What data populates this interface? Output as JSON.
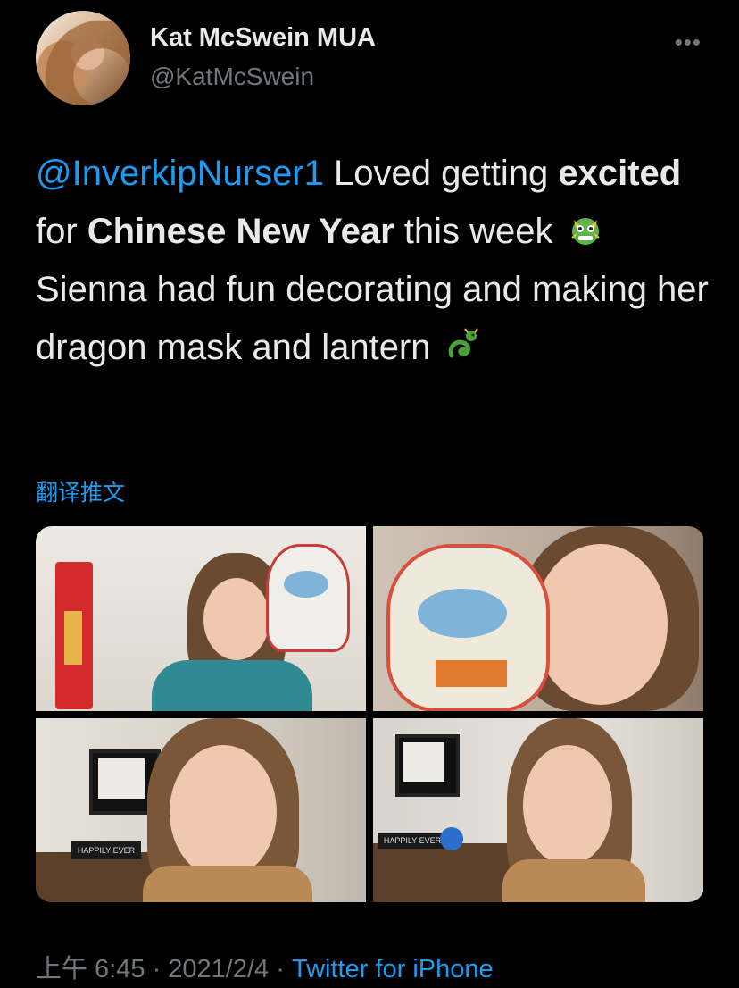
{
  "author": {
    "display_name": "Kat McSwein MUA",
    "handle": "@KatMcSwein"
  },
  "tweet": {
    "mention": "@InverkipNurser1",
    "t1": " Loved getting ",
    "b1": "excited",
    "t2": " for ",
    "b2": "Chinese New Year",
    "t3": " this week ",
    "t4": " Sienna had fun decorating and making her dragon mask and lantern ",
    "emoji1": "dragon-face-icon",
    "emoji2": "dragon-icon"
  },
  "translate_label": "翻译推文",
  "footer": {
    "time": "上午 6:45",
    "date": "2021/2/4",
    "separator": "·",
    "source": "Twitter for iPhone"
  },
  "media": {
    "photos": [
      "photo-1",
      "photo-2",
      "photo-3",
      "photo-4"
    ],
    "sign_text": "HAPPILY EVER"
  },
  "colors": {
    "accent": "#1d9bf0",
    "background": "#000000",
    "text": "#e7e9ea",
    "secondary": "#71767b"
  }
}
